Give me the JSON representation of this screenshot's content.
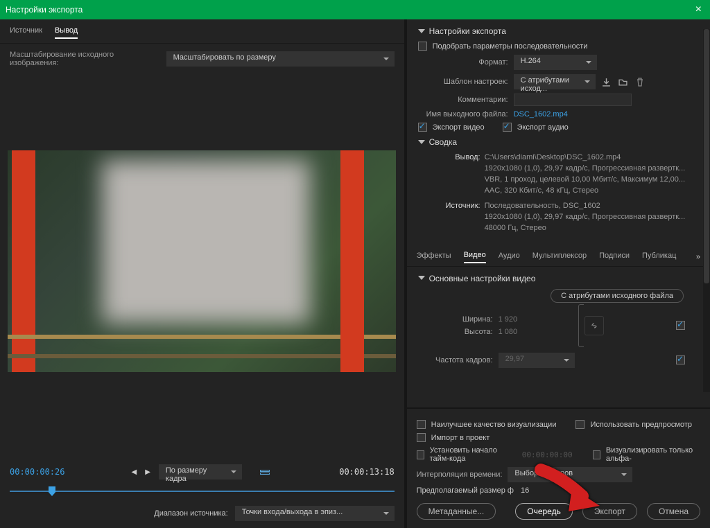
{
  "titlebar": {
    "title": "Настройки экспорта"
  },
  "leftTabs": {
    "source": "Источник",
    "output": "Вывод"
  },
  "scaling": {
    "label": "Масштабирование исходного изображения:",
    "value": "Масштабировать по размеру"
  },
  "playback": {
    "tcStart": "00:00:00:26",
    "tcEnd": "00:00:13:18",
    "fit": "По размеру кадра"
  },
  "rangeRow": {
    "label": "Диапазон источника:",
    "value": "Точки входа/выхода в эпиз..."
  },
  "export": {
    "sectionTitle": "Настройки экспорта",
    "matchSequence": "Подобрать параметры последовательности",
    "formatLabel": "Формат:",
    "format": "H.264",
    "presetLabel": "Шаблон настроек:",
    "preset": "С атрибутами исход...",
    "commentLabel": "Комментарии:",
    "outNameLabel": "Имя выходного файла:",
    "outName": "DSC_1602.mp4",
    "exportVideo": "Экспорт видео",
    "exportAudio": "Экспорт аудио",
    "summaryTitle": "Сводка",
    "summaryOutLabel": "Вывод:",
    "summaryOut1": "C:\\Users\\diami\\Desktop\\DSC_1602.mp4",
    "summaryOut2": "1920x1080 (1,0), 29,97 кадр/с, Прогрессивная развертк...",
    "summaryOut3": "VBR, 1 проход, целевой 10,00 Мбит/с, Максимум 12,00...",
    "summaryOut4": "AAC, 320 Кбит/с, 48 кГц, Стерео",
    "summarySrcLabel": "Источник:",
    "summarySrc1": "Последовательность, DSC_1602",
    "summarySrc2": "1920x1080 (1,0), 29,97 кадр/с, Прогрессивная развертк...",
    "summarySrc3": "48000 Гц, Стерео"
  },
  "subtabs": {
    "effects": "Эффекты",
    "video": "Видео",
    "audio": "Аудио",
    "mux": "Мультиплексор",
    "cc": "Подписи",
    "pub": "Публикац"
  },
  "videoSettings": {
    "sectionTitle": "Основные настройки видео",
    "matchSource": "С атрибутами исходного файла",
    "widthLabel": "Ширина:",
    "width": "1 920",
    "heightLabel": "Высота:",
    "height": "1 080",
    "fpsLabel": "Частота кадров:",
    "fps": "29,97"
  },
  "bottom": {
    "maxQuality": "Наилучшее качество визуализации",
    "usePreviews": "Использовать предпросмотр",
    "importProject": "Импорт в проект",
    "setStartTC": "Установить начало тайм-кода",
    "startTC": "00:00:00:00",
    "renderAlpha": "Визуализировать только альфа-",
    "timeInterpLabel": "Интерполяция времени:",
    "timeInterp": "Выборка кадров",
    "estimateLabel": "Предполагаемый размер ф",
    "estimateValTrunc": "16",
    "metadata": "Метаданные...",
    "queue": "Очередь",
    "export": "Экспорт",
    "cancel": "Отмена"
  }
}
